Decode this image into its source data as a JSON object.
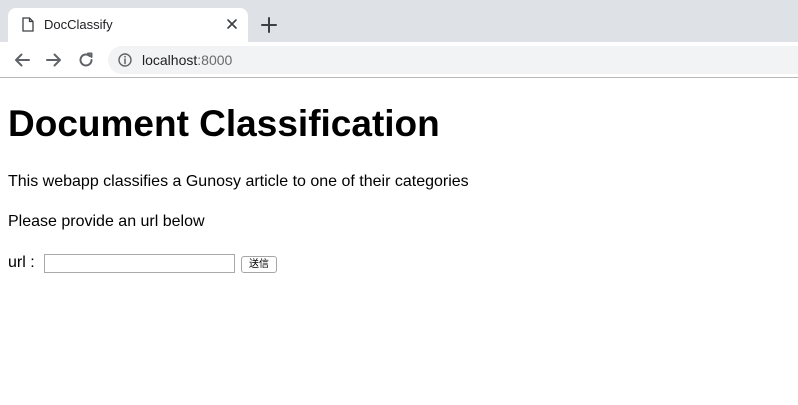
{
  "browser": {
    "tab": {
      "title": "DocClassify",
      "favicon": "document-icon",
      "close_icon": "close-icon"
    },
    "new_tab_icon": "plus-icon",
    "nav": {
      "back_icon": "arrow-left-icon",
      "forward_icon": "arrow-right-icon",
      "reload_icon": "reload-icon"
    },
    "address_bar": {
      "info_icon": "info-icon",
      "host": "localhost",
      "port": ":8000"
    }
  },
  "page": {
    "title": "Document Classification",
    "description": "This webapp classifies a Gunosy article to one of their categories",
    "instruction": "Please provide an url below",
    "form": {
      "url_label": "url :",
      "url_value": "",
      "submit_label": "送信"
    }
  }
}
